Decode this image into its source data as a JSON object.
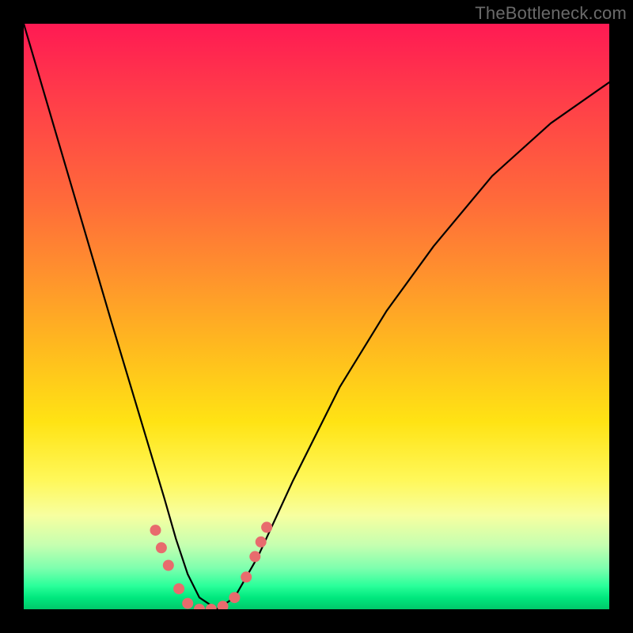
{
  "watermark": "TheBottleneck.com",
  "chart_data": {
    "type": "line",
    "title": "",
    "xlabel": "",
    "ylabel": "",
    "xlim": [
      0,
      1
    ],
    "ylim": [
      0,
      1
    ],
    "note": "Bottleneck-style V-curve; axes unlabeled; y=1 near top (red), y≈0 at bottom (green). x is normalized horizontal position.",
    "series": [
      {
        "name": "bottleneck-curve",
        "x": [
          0.0,
          0.05,
          0.1,
          0.15,
          0.18,
          0.21,
          0.24,
          0.26,
          0.28,
          0.3,
          0.33,
          0.36,
          0.4,
          0.46,
          0.54,
          0.62,
          0.7,
          0.8,
          0.9,
          1.0
        ],
        "y": [
          1.0,
          0.83,
          0.66,
          0.49,
          0.39,
          0.29,
          0.19,
          0.12,
          0.06,
          0.02,
          0.0,
          0.02,
          0.09,
          0.22,
          0.38,
          0.51,
          0.62,
          0.74,
          0.83,
          0.9
        ]
      }
    ],
    "highlight_markers": {
      "note": "Salmon dotted segments near bottom of V (just above green band) on both sides plus along the flat bottom.",
      "points_xy": [
        [
          0.225,
          0.135
        ],
        [
          0.235,
          0.105
        ],
        [
          0.247,
          0.075
        ],
        [
          0.265,
          0.035
        ],
        [
          0.28,
          0.01
        ],
        [
          0.3,
          0.0
        ],
        [
          0.32,
          0.0
        ],
        [
          0.34,
          0.005
        ],
        [
          0.36,
          0.02
        ],
        [
          0.38,
          0.055
        ],
        [
          0.395,
          0.09
        ],
        [
          0.405,
          0.115
        ],
        [
          0.415,
          0.14
        ]
      ]
    },
    "background_gradient": {
      "stops": [
        {
          "pos": 0.0,
          "color": "#ff1a53"
        },
        {
          "pos": 0.3,
          "color": "#ff6a3a"
        },
        {
          "pos": 0.55,
          "color": "#ffb91f"
        },
        {
          "pos": 0.78,
          "color": "#fff85a"
        },
        {
          "pos": 0.93,
          "color": "#7dffae"
        },
        {
          "pos": 1.0,
          "color": "#00c96a"
        }
      ]
    }
  }
}
